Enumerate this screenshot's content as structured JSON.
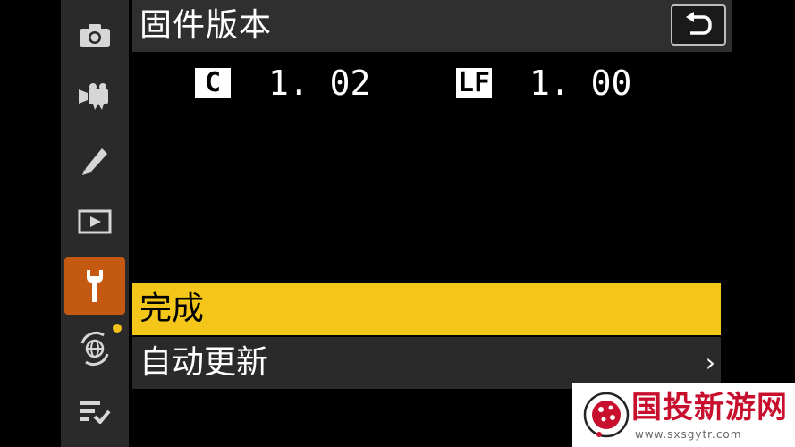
{
  "sidebar": {
    "items": [
      {
        "icon": "camera-icon"
      },
      {
        "icon": "video-camera-icon"
      },
      {
        "icon": "pencil-icon"
      },
      {
        "icon": "playback-icon"
      },
      {
        "icon": "wrench-icon",
        "active": true
      },
      {
        "icon": "network-icon"
      },
      {
        "icon": "my-menu-icon"
      }
    ],
    "active_color": "#c45a12",
    "notification_dot_color": "#f2c21a"
  },
  "header": {
    "title": "固件版本",
    "back_icon": "back-arrow-icon"
  },
  "firmware": {
    "c_label": "C",
    "c_version": "1. 02",
    "lf_label": "LF",
    "lf_version": "1. 00"
  },
  "menu": {
    "items": [
      {
        "label": "完成",
        "selected": true
      },
      {
        "label": "自动更新",
        "chevron": "›"
      }
    ],
    "selected_color": "#f5c61a"
  },
  "watermark": {
    "title": "国投新游网",
    "subtitle": "www.sxsgytr.com",
    "color": "#c8102e"
  }
}
